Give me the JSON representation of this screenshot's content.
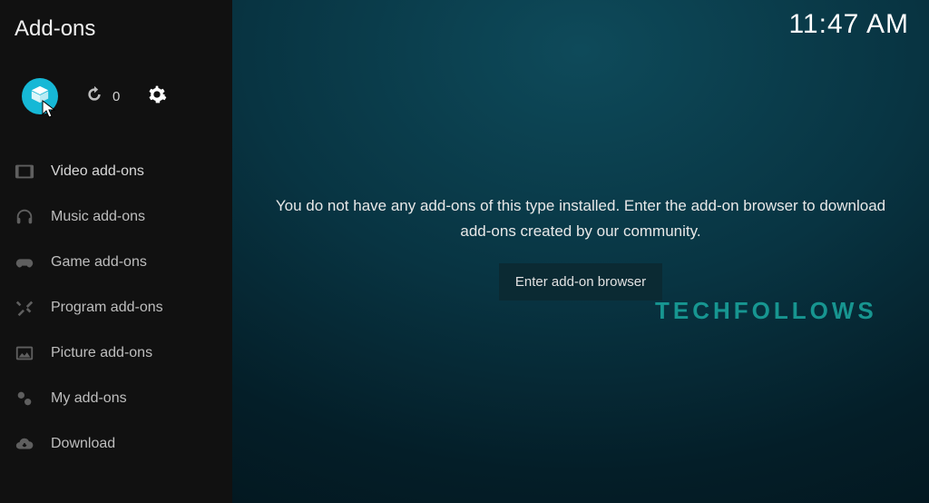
{
  "header": {
    "title": "Add-ons",
    "clock": "11:47 AM"
  },
  "toolbar": {
    "update_count": "0"
  },
  "nav": {
    "items": [
      {
        "label": "Video add-ons"
      },
      {
        "label": "Music add-ons"
      },
      {
        "label": "Game add-ons"
      },
      {
        "label": "Program add-ons"
      },
      {
        "label": "Picture add-ons"
      },
      {
        "label": "My add-ons"
      },
      {
        "label": "Download"
      }
    ]
  },
  "main": {
    "empty_message": "You do not have any add-ons of this type installed. Enter the add-on browser to download add-ons created by our community.",
    "enter_button": "Enter add-on browser"
  },
  "watermark": "TECHFOLLOWS"
}
